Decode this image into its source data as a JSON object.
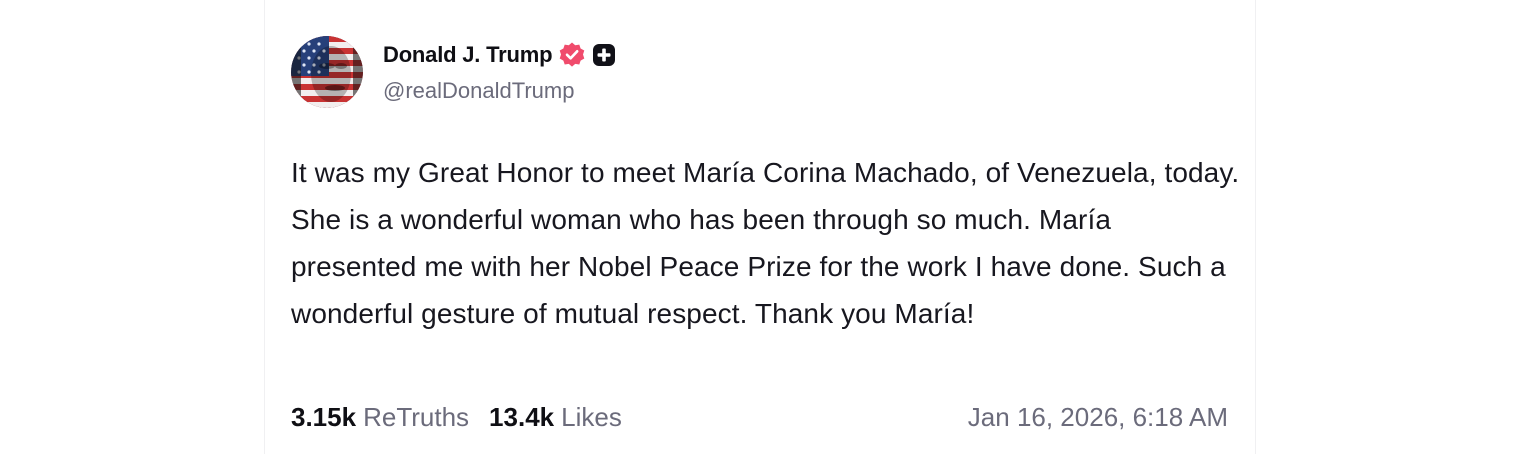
{
  "post": {
    "author": {
      "display_name": "Donald J. Trump",
      "handle": "@realDonaldTrump",
      "avatar_icon": "flag-face-avatar",
      "verified_icon": "verified-badge-icon",
      "verified_color": "#f04b6c",
      "plus_icon": "plus-badge-icon"
    },
    "text": "It was my Great Honor to meet María Corina Machado, of Venezuela, today. She is a wonderful woman who has been through so much. María presented me with her Nobel Peace Prize for the work I have done. Such a wonderful gesture of mutual respect. Thank you María!",
    "stats": {
      "retruths_count": "3.15k",
      "retruths_label": "ReTruths",
      "likes_count": "13.4k",
      "likes_label": "Likes"
    },
    "timestamp": "Jan 16, 2026, 6:18 AM"
  }
}
